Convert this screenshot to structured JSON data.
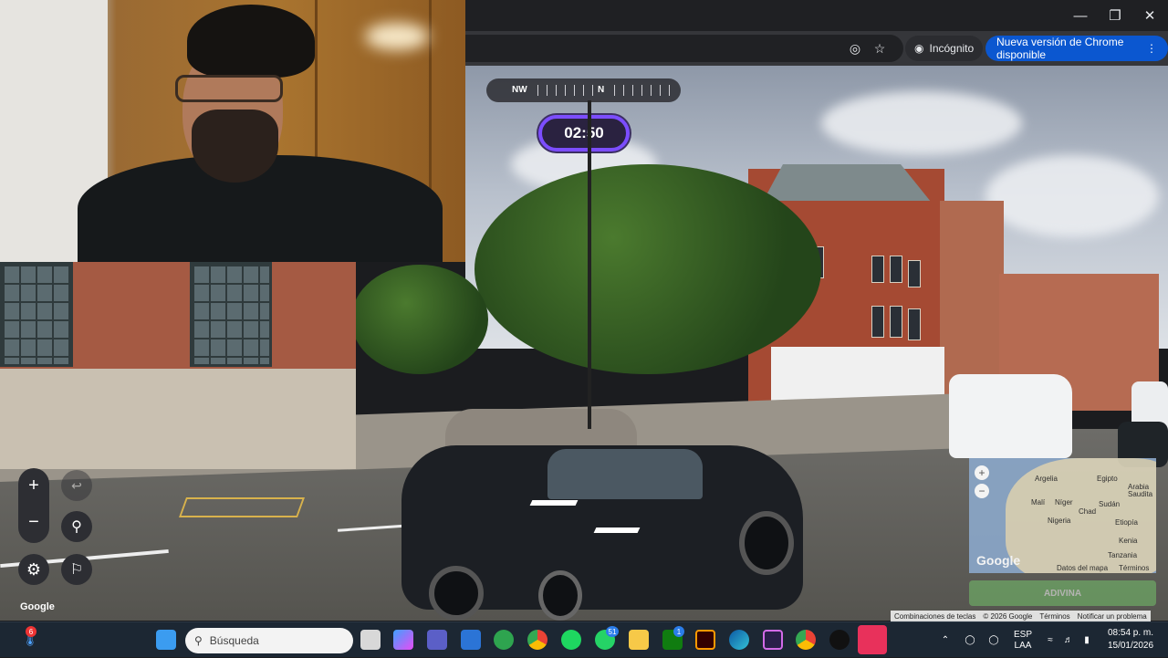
{
  "window": {
    "minimize_icon": "minimize-icon",
    "maximize_icon": "restore-icon",
    "close_icon": "close-icon"
  },
  "toolbar": {
    "incognito_label": "Incógnito",
    "update_label": "Nueva versión de Chrome disponible"
  },
  "game": {
    "compass": {
      "left": "NW",
      "right": "N"
    },
    "timer": "02:50",
    "google_logo": "Google",
    "minimap": {
      "labels": [
        "Argelia",
        "Egipto",
        "Arabia Saudita",
        "Malí",
        "Níger",
        "Chad",
        "Sudán",
        "Nigeria",
        "Etiopía",
        "Kenia",
        "Tanzania"
      ],
      "logo": "Google",
      "data_label": "Datos del mapa",
      "terms_label": "Términos"
    },
    "guess_button": "ADIVINA"
  },
  "attribution": {
    "shortcuts": "Combinaciones de teclas",
    "copyright": "© 2026 Google",
    "terms": "Términos",
    "report": "Notificar un problema"
  },
  "taskbar": {
    "weather_badge": "6",
    "search_placeholder": "Búsqueda",
    "whatsapp_badge": "51",
    "xbox_badge": "1",
    "language_line1": "ESP",
    "language_line2": "LAA",
    "time": "08:54 p. m.",
    "date": "15/01/2026"
  },
  "colors": {
    "accent": "#0b57d0",
    "timer_border": "#7c4dff",
    "taskbar": "#1c2733"
  }
}
